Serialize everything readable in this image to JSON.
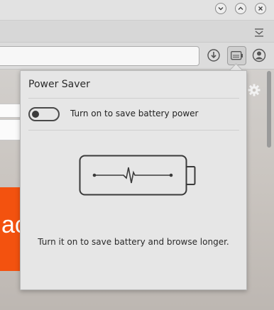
{
  "popup": {
    "title": "Power Saver",
    "toggle_label": "Turn on to save battery power",
    "toggle_state": "off",
    "description": "Turn it on to save battery and browse longer."
  },
  "background_page": {
    "fragment_text": "ac"
  },
  "icons": {
    "window_buttons": [
      "minimize-icon",
      "maximize-icon",
      "close-icon"
    ],
    "tab_menu": "tab-list-icon",
    "toolbar": [
      "download-icon",
      "power-saver-icon",
      "profile-icon"
    ],
    "settings": "gear-icon",
    "illustration": "battery-icon"
  },
  "colors": {
    "accent_orange": "#f3520f",
    "popup_bg": "#e6e6e6"
  }
}
